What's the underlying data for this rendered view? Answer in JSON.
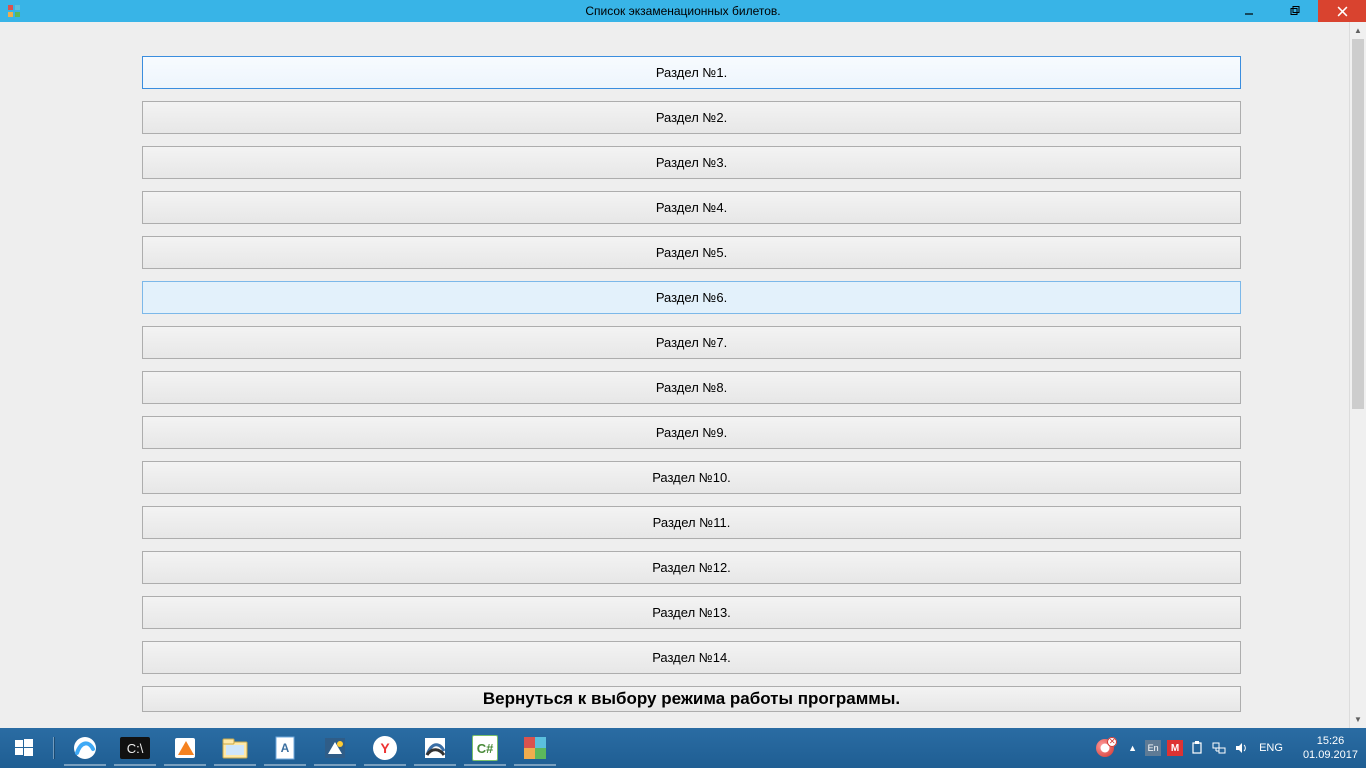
{
  "window": {
    "title": "Список экзаменационных билетов."
  },
  "sections": [
    {
      "label": "Раздел №1.",
      "state": "selected"
    },
    {
      "label": "Раздел №2.",
      "state": "normal"
    },
    {
      "label": "Раздел №3.",
      "state": "normal"
    },
    {
      "label": "Раздел №4.",
      "state": "normal"
    },
    {
      "label": "Раздел №5.",
      "state": "normal"
    },
    {
      "label": "Раздел №6.",
      "state": "highlight"
    },
    {
      "label": "Раздел №7.",
      "state": "normal"
    },
    {
      "label": "Раздел №8.",
      "state": "normal"
    },
    {
      "label": "Раздел №9.",
      "state": "normal"
    },
    {
      "label": "Раздел №10.",
      "state": "normal"
    },
    {
      "label": "Раздел №11.",
      "state": "normal"
    },
    {
      "label": "Раздел №12.",
      "state": "normal"
    },
    {
      "label": "Раздел №13.",
      "state": "normal"
    },
    {
      "label": "Раздел №14.",
      "state": "normal"
    }
  ],
  "return_button": "Вернуться к выбору режима работы программы.",
  "taskbar": {
    "lang": "ENG",
    "time": "15:26",
    "date": "01.09.2017"
  }
}
